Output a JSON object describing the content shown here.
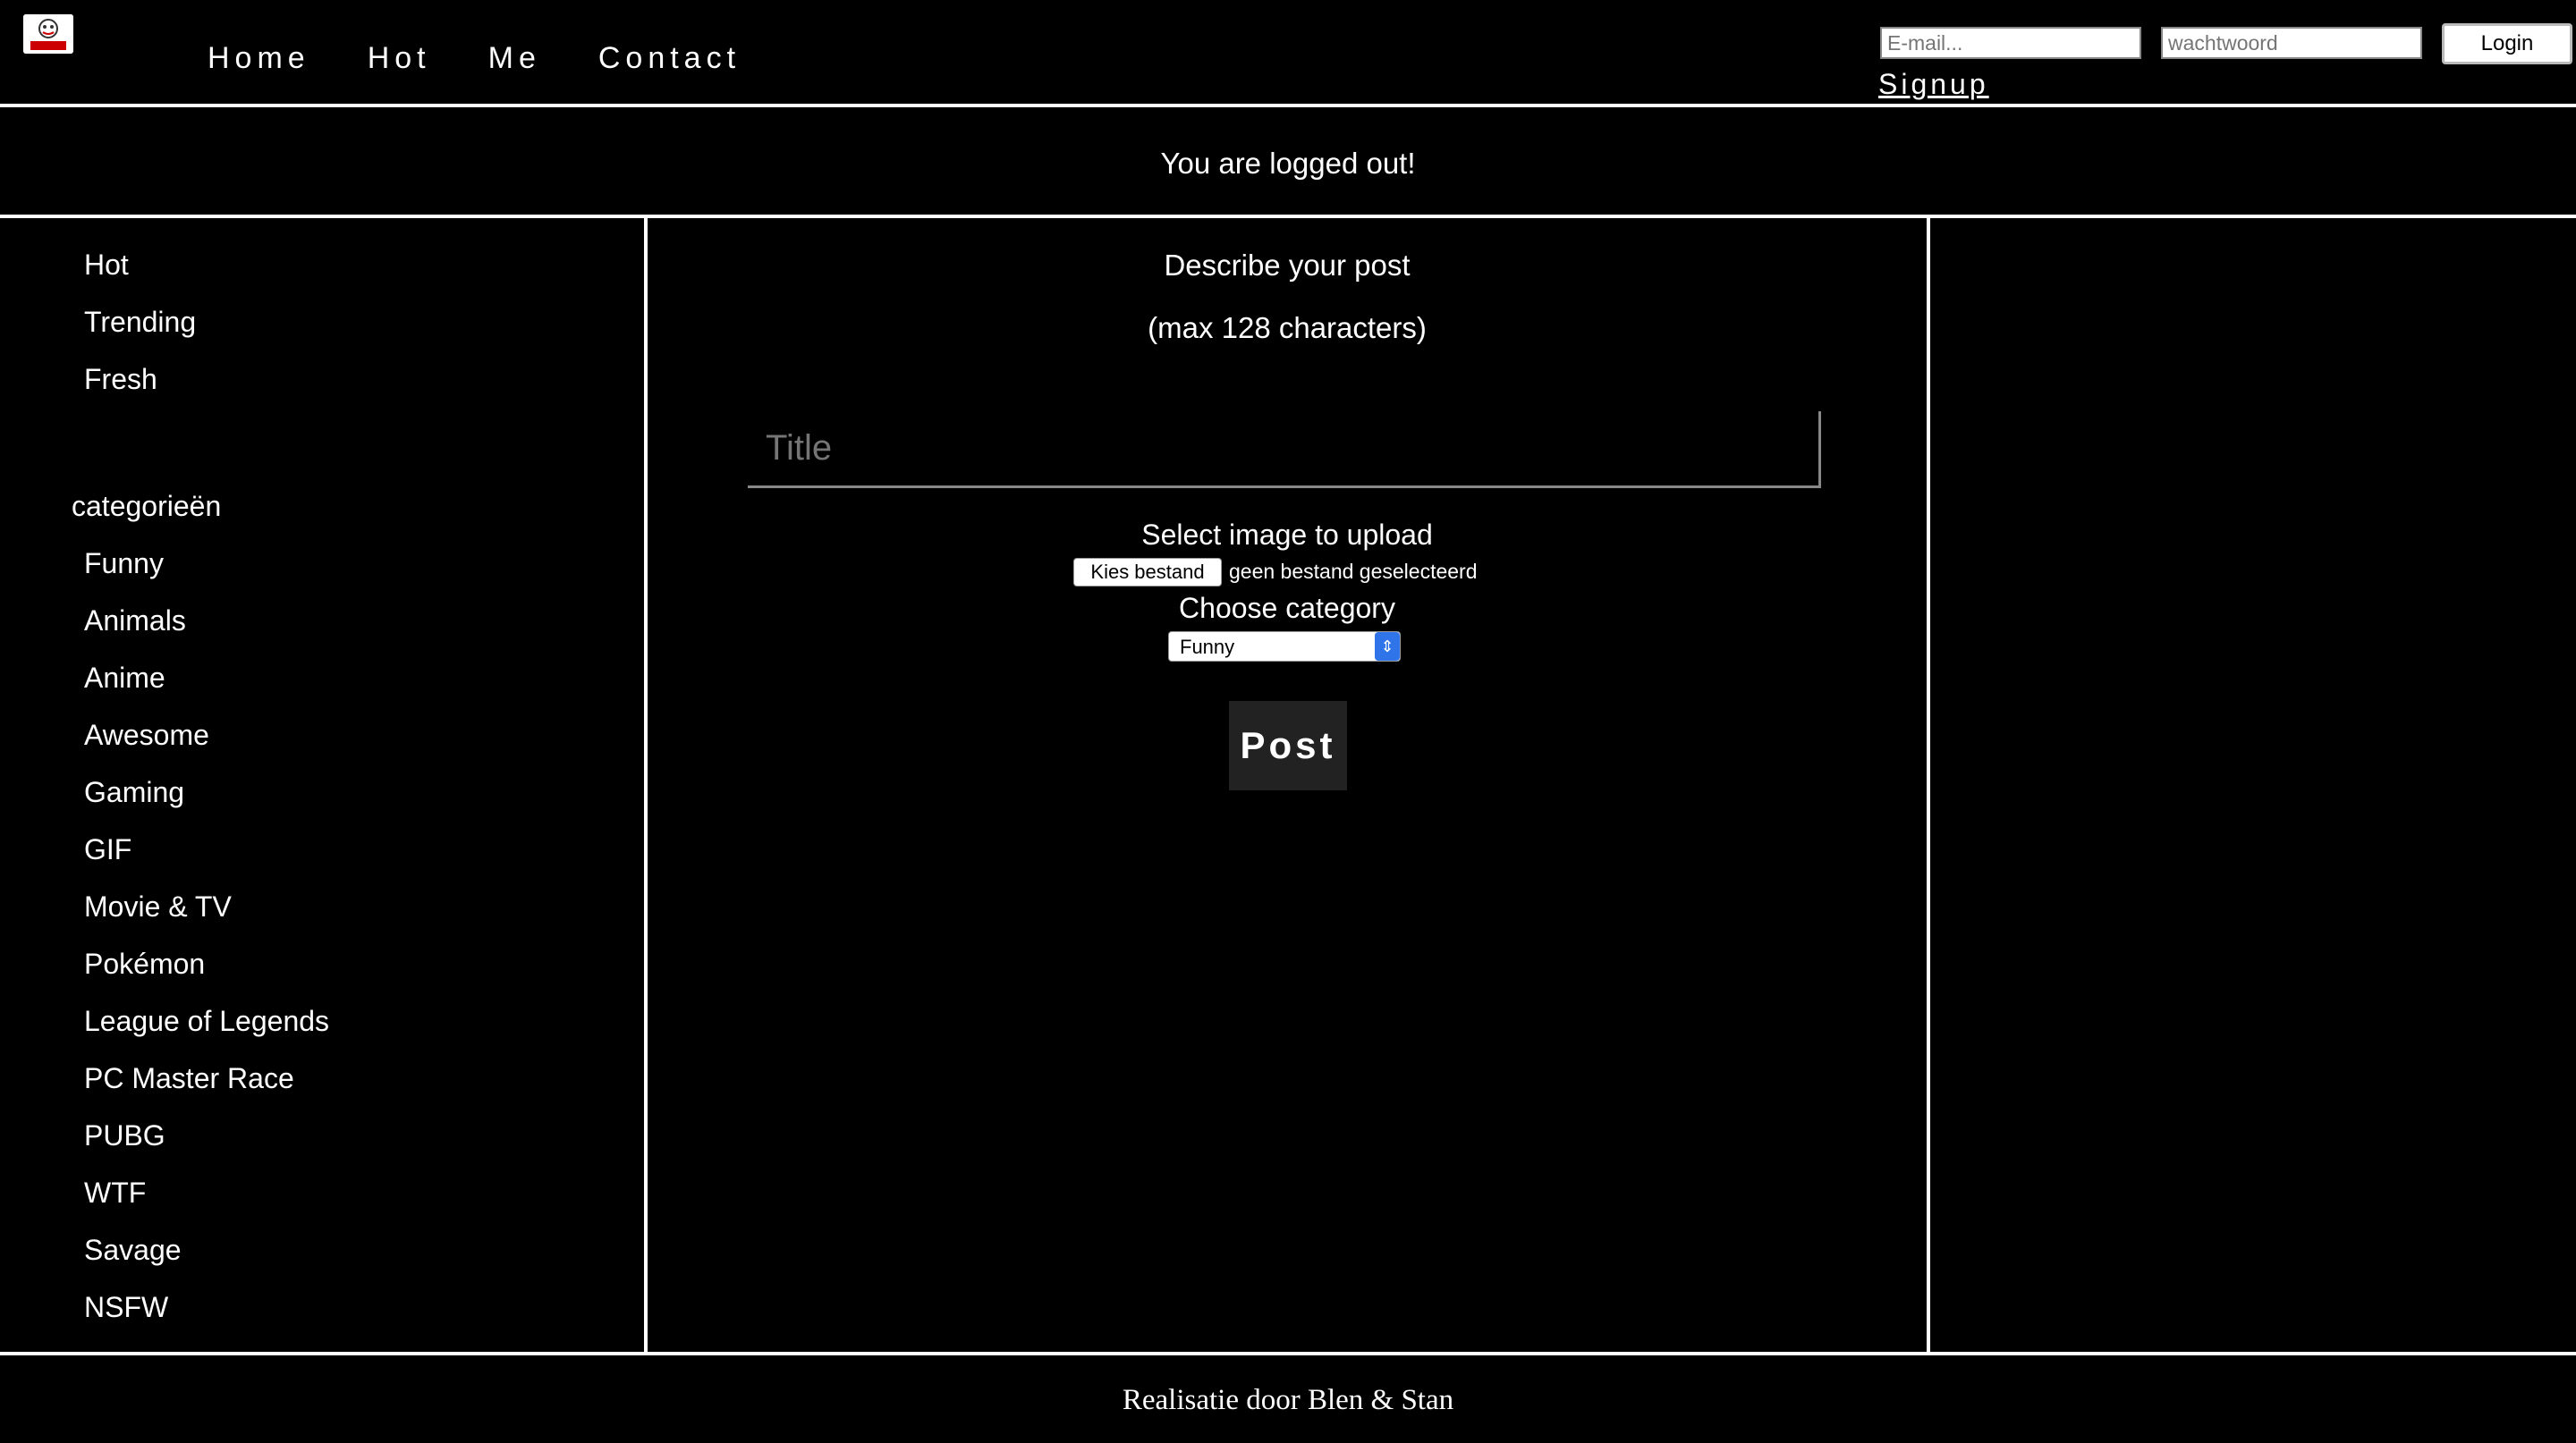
{
  "header": {
    "logo_alt": "logo",
    "nav": [
      "Home",
      "Hot",
      "Me",
      "Contact"
    ],
    "email_placeholder": "E-mail...",
    "password_placeholder": "wachtwoord",
    "login_label": "Login",
    "signup_label": "Signup"
  },
  "message": "You are logged out!",
  "sidebar": {
    "top_items": [
      "Hot",
      "Trending",
      "Fresh"
    ],
    "categories_heading": "categorieën",
    "categories": [
      "Funny",
      "Animals",
      "Anime",
      "Awesome",
      "Gaming",
      "GIF",
      "Movie & TV",
      "Pokémon",
      "League of Legends",
      "PC Master Race",
      "PUBG",
      "WTF",
      "Savage",
      "NSFW"
    ]
  },
  "form": {
    "describe_label": "Describe your post",
    "max_label": "(max 128 characters)",
    "title_placeholder": "Title",
    "image_label": "Select image to upload",
    "file_button_label": "Kies bestand",
    "file_status": "geen bestand geselecteerd",
    "category_label": "Choose category",
    "category_selected": "Funny",
    "post_label": "Post"
  },
  "footer": {
    "credit": "Realisatie door Blen & Stan"
  },
  "colors": {
    "background": "#000000",
    "text": "#ffffff",
    "select_arrow": "#2f74e8",
    "post_button": "#222222"
  }
}
